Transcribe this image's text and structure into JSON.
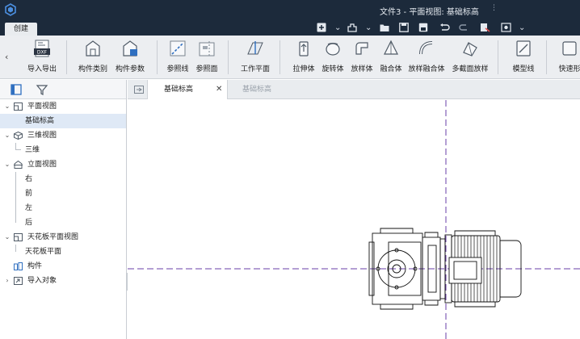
{
  "window": {
    "title": "文件3 - 平面视图: 基础标高",
    "title_menu_glyph": "⋮"
  },
  "ribbon_tab": {
    "label": "创建"
  },
  "quick_access": {
    "items": [
      "new-icon",
      "template-icon",
      "open-icon",
      "save-icon",
      "save-as-icon",
      "undo-icon",
      "redo-icon",
      "export-icon",
      "settings-icon"
    ],
    "dropdown_glyph": "⌄"
  },
  "ribbon": {
    "scroll_left": "‹",
    "buttons": [
      {
        "label": "导入导出",
        "icon": "dxf-import-export-icon",
        "badge": "DXF"
      },
      {
        "label": "构件类别",
        "icon": "component-category-icon"
      },
      {
        "label": "构件参数",
        "icon": "component-params-icon"
      },
      {
        "label": "参照线",
        "icon": "reference-line-icon"
      },
      {
        "label": "参照面",
        "icon": "reference-plane-icon"
      },
      {
        "label": "工作平面",
        "icon": "work-plane-icon"
      },
      {
        "label": "拉伸体",
        "icon": "extrude-icon"
      },
      {
        "label": "旋转体",
        "icon": "revolve-icon"
      },
      {
        "label": "放样体",
        "icon": "sweep-icon"
      },
      {
        "label": "融合体",
        "icon": "blend-icon"
      },
      {
        "label": "放样融合体",
        "icon": "swept-blend-icon"
      },
      {
        "label": "多截面放样",
        "icon": "multi-section-loft-icon"
      },
      {
        "label": "模型线",
        "icon": "model-line-icon"
      },
      {
        "label": "快速形",
        "icon": "quick-shape-icon"
      }
    ]
  },
  "left_panel": {
    "toolbar": [
      "panel-toggle-icon",
      "filter-icon"
    ],
    "collapse_glyph": "‹",
    "tree": [
      {
        "label": "平面视图",
        "level": 0,
        "expanded": true,
        "icon": "plan-view-icon"
      },
      {
        "label": "基础标高",
        "level": 1,
        "selected": true
      },
      {
        "label": "三维视图",
        "level": 0,
        "expanded": true,
        "icon": "3d-view-icon"
      },
      {
        "label": "三维",
        "level": 1
      },
      {
        "label": "立面视图",
        "level": 0,
        "expanded": true,
        "icon": "elevation-view-icon"
      },
      {
        "label": "右",
        "level": 1
      },
      {
        "label": "前",
        "level": 1
      },
      {
        "label": "左",
        "level": 1
      },
      {
        "label": "后",
        "level": 1
      },
      {
        "label": "天花板平面视图",
        "level": 0,
        "expanded": true,
        "icon": "ceiling-plan-icon"
      },
      {
        "label": "天花板平面",
        "level": 1
      },
      {
        "label": "构件",
        "level": 0,
        "icon": "component-icon"
      },
      {
        "label": "导入对象",
        "level": 0,
        "expanded": false,
        "icon": "import-object-icon"
      }
    ]
  },
  "doc_tabs": {
    "tabs": [
      {
        "label": "基础标高",
        "active": true,
        "close": "✕"
      },
      {
        "label": "基础标高",
        "active": false
      }
    ]
  },
  "colors": {
    "titlebar": "#1c2a3b",
    "ribbon_bg": "#eceef1",
    "selection": "#dfe9f6",
    "reference_line": "#6a3fa8",
    "drawing": "#111111"
  }
}
